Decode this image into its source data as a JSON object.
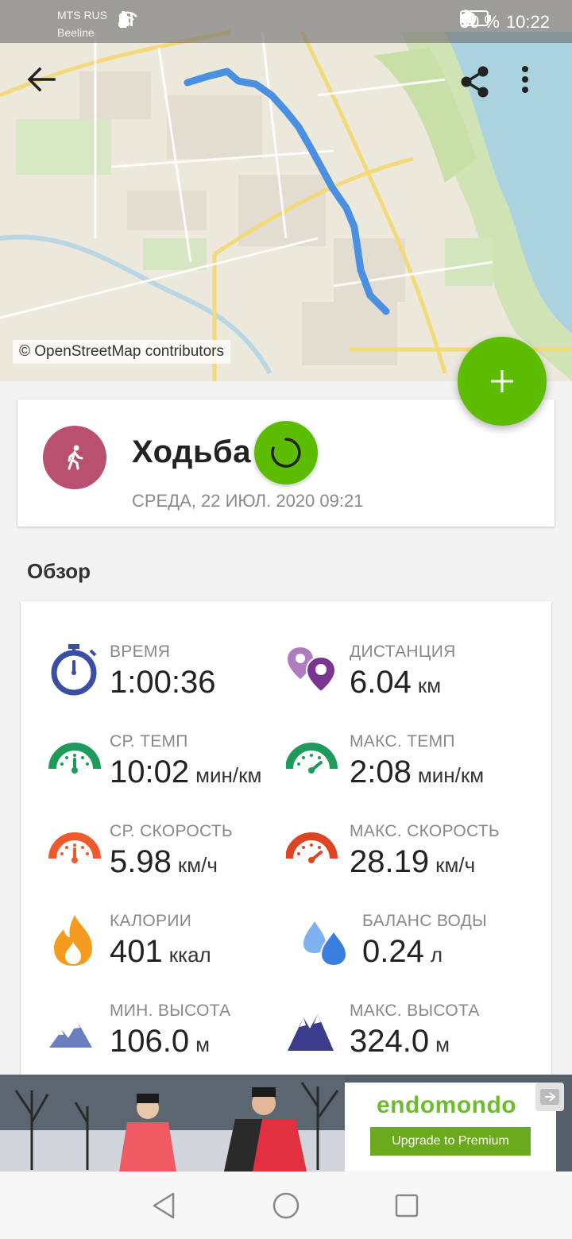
{
  "status_bar": {
    "carrier_1": "MTS RUS",
    "carrier_2": "Beeline",
    "battery": "50 %",
    "time": "10:22"
  },
  "map": {
    "attribution": "© OpenStreetMap contributors",
    "route_color": "#4a90e2"
  },
  "toolbar": {
    "back_icon": "arrow-back-icon",
    "share_icon": "share-icon",
    "more_icon": "more-vert-icon"
  },
  "fab": {
    "icon": "plus-icon",
    "color": "#5cbd00"
  },
  "activity": {
    "name": "Ходьба",
    "date": "СРЕДА, 22 ИЮЛ. 2020 09:21",
    "sport_icon": "walking-icon",
    "avatar_color": "#b8506e",
    "sync_icon": "sync-icon"
  },
  "overview": {
    "title": "Обзор",
    "stats": [
      {
        "label": "ВРЕМЯ",
        "value": "1:00:36",
        "unit": "",
        "icon": "stopwatch-icon"
      },
      {
        "label": "ДИСТАНЦИЯ",
        "value": "6.04",
        "unit": "км",
        "icon": "map-pins-icon"
      },
      {
        "label": "СР. ТЕМП",
        "value": "10:02",
        "unit": "мин/км",
        "icon": "avg-pace-gauge-icon"
      },
      {
        "label": "МАКС. ТЕМП",
        "value": "2:08",
        "unit": "мин/км",
        "icon": "max-pace-gauge-icon"
      },
      {
        "label": "СР. СКОРОСТЬ",
        "value": "5.98",
        "unit": "км/ч",
        "icon": "avg-speed-gauge-icon"
      },
      {
        "label": "МАКС. СКОРОСТЬ",
        "value": "28.19",
        "unit": "км/ч",
        "icon": "max-speed-gauge-icon"
      },
      {
        "label": "КАЛОРИИ",
        "value": "401",
        "unit": "ккал",
        "icon": "flame-icon"
      },
      {
        "label": "БАЛАНС ВОДЫ",
        "value": "0.24",
        "unit": "л",
        "icon": "water-drops-icon"
      },
      {
        "label": "МИН. ВЫСОТА",
        "value": "106.0",
        "unit": "м",
        "icon": "min-altitude-mountains-icon"
      },
      {
        "label": "МАКС. ВЫСОТА",
        "value": "324.0",
        "unit": "м",
        "icon": "max-altitude-mountains-icon"
      }
    ]
  },
  "ad": {
    "brand": "endomondo",
    "cta": "Upgrade to Premium",
    "close_icon": "ad-close-icon"
  },
  "nav": {
    "back_icon": "nav-back-triangle-icon",
    "home_icon": "nav-home-circle-icon",
    "recents_icon": "nav-recents-square-icon"
  }
}
